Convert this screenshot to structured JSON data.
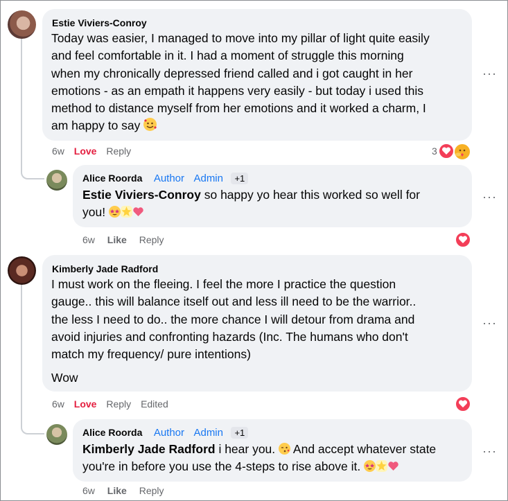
{
  "comments": [
    {
      "author": "Estie Viviers-Conroy",
      "text_lines": [
        "Today was easier, I managed to move into my pillar of light quite easily",
        "and feel comfortable in it. I had a moment of struggle this morning",
        "when my chronically depressed friend called and i got caught in her",
        "emotions - as an empath it happens very easily - but today i used this",
        "method to distance myself from her emotions and it worked a charm, I",
        "am happy to say"
      ],
      "emojis": [
        "smiling-face-with-hearts-emoji"
      ],
      "time": "6w",
      "reaction_action": "Love",
      "reply_label": "Reply",
      "reaction_count": "3",
      "reaction_icons": [
        "heart-reaction-icon",
        "care-reaction-icon"
      ],
      "more_label": "···",
      "reply": {
        "author": "Alice Roorda",
        "badges": [
          "Author",
          "Admin"
        ],
        "extra_badges": "+1",
        "mention": "Estie Viviers-Conroy",
        "text_line1": " so happy yo hear this worked so well for",
        "text_line2": "you!",
        "emojis": [
          "star-struck-emoji",
          "glowing-star-emoji",
          "sparkling-heart-emoji"
        ],
        "time": "6w",
        "reaction_action": "Like",
        "reply_label": "Reply",
        "reaction_icons": [
          "heart-reaction-icon"
        ],
        "more_label": "···"
      }
    },
    {
      "author": "Kimberly Jade Radford",
      "text_lines": [
        "I must work on the fleeing. I feel the more I practice the question",
        "gauge.. this will balance itself out and less ill need to be the warrior..",
        "the less I need to do.. the more chance I will detour from drama and",
        "avoid injuries and confronting hazards (Inc. The humans who don't",
        "match my frequency/ pure intentions)"
      ],
      "second_paragraph": "Wow",
      "time": "6w",
      "reaction_action": "Love",
      "reply_label": "Reply",
      "edited_label": "Edited",
      "reaction_icons": [
        "heart-reaction-icon"
      ],
      "more_label": "···",
      "reply": {
        "author": "Alice Roorda",
        "badges": [
          "Author",
          "Admin"
        ],
        "extra_badges": "+1",
        "mention": "Kimberly Jade Radford",
        "text_line1": " i hear you.",
        "text_line1_after": " And accept whatever state",
        "text_line2": "you're in before you use the 4-steps to rise above it.",
        "emojis": [
          "face-blowing-kiss-emoji",
          "star-struck-emoji",
          "glowing-star-emoji",
          "sparkling-heart-emoji"
        ],
        "time": "6w",
        "reaction_action": "Like",
        "reply_label": "Reply",
        "more_label": "···"
      }
    }
  ],
  "colors": {
    "bubble": "#f0f2f5",
    "love": "#e41e3f",
    "badge": "#1877f2",
    "meta": "#65676b"
  }
}
